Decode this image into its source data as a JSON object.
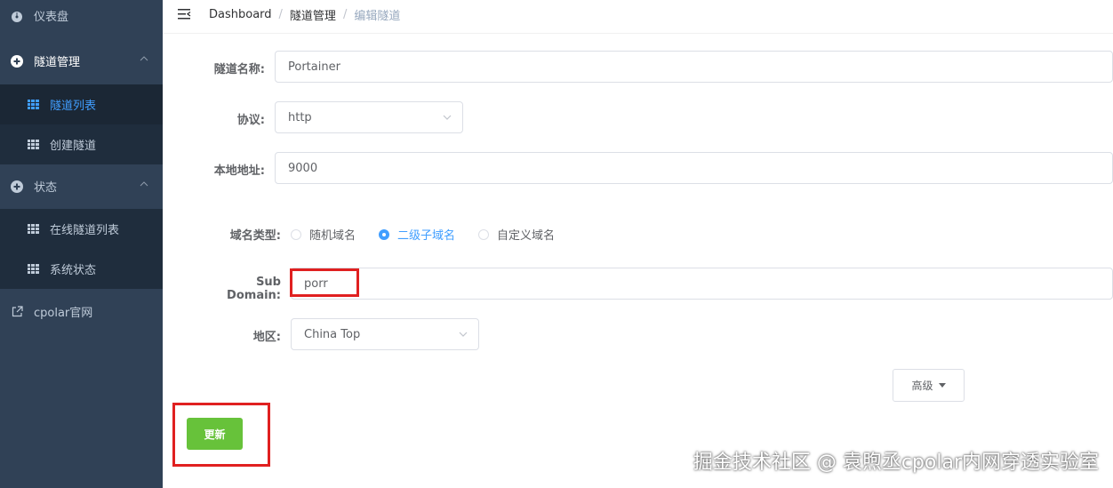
{
  "sidebar": {
    "items": [
      {
        "label": "仪表盘",
        "icon": "dashboard-icon"
      },
      {
        "label": "隧道管理",
        "icon": "plus-circle-icon"
      },
      {
        "label": "隧道列表",
        "icon": "grid-icon",
        "active": true
      },
      {
        "label": "创建隧道",
        "icon": "grid-icon"
      },
      {
        "label": "状态",
        "icon": "plus-circle-icon"
      },
      {
        "label": "在线隧道列表",
        "icon": "grid-icon"
      },
      {
        "label": "系统状态",
        "icon": "grid-icon"
      },
      {
        "label": "cpolar官网",
        "icon": "external-link-icon"
      }
    ]
  },
  "breadcrumb": [
    "Dashboard",
    "隧道管理",
    "编辑隧道"
  ],
  "form": {
    "name_label": "隧道名称:",
    "name_value": "Portainer",
    "protocol_label": "协议:",
    "protocol_value": "http",
    "local_label": "本地地址:",
    "local_value": "9000",
    "domain_type_label": "域名类型:",
    "domain_types": [
      "随机域名",
      "二级子域名",
      "自定义域名"
    ],
    "domain_type_selected": "二级子域名",
    "subdomain_label": "Sub Domain:",
    "subdomain_value": "porr",
    "region_label": "地区:",
    "region_value": "China Top"
  },
  "buttons": {
    "advanced": "高级",
    "update": "更新"
  },
  "watermark": "掘金技术社区 @ 袁煦丞cpolar内网穿透实验室",
  "colors": {
    "sidebar_bg": "#304156",
    "submenu_bg": "#1f2d3d",
    "accent": "#409eff",
    "success": "#67c23a",
    "highlight": "#e02020"
  }
}
